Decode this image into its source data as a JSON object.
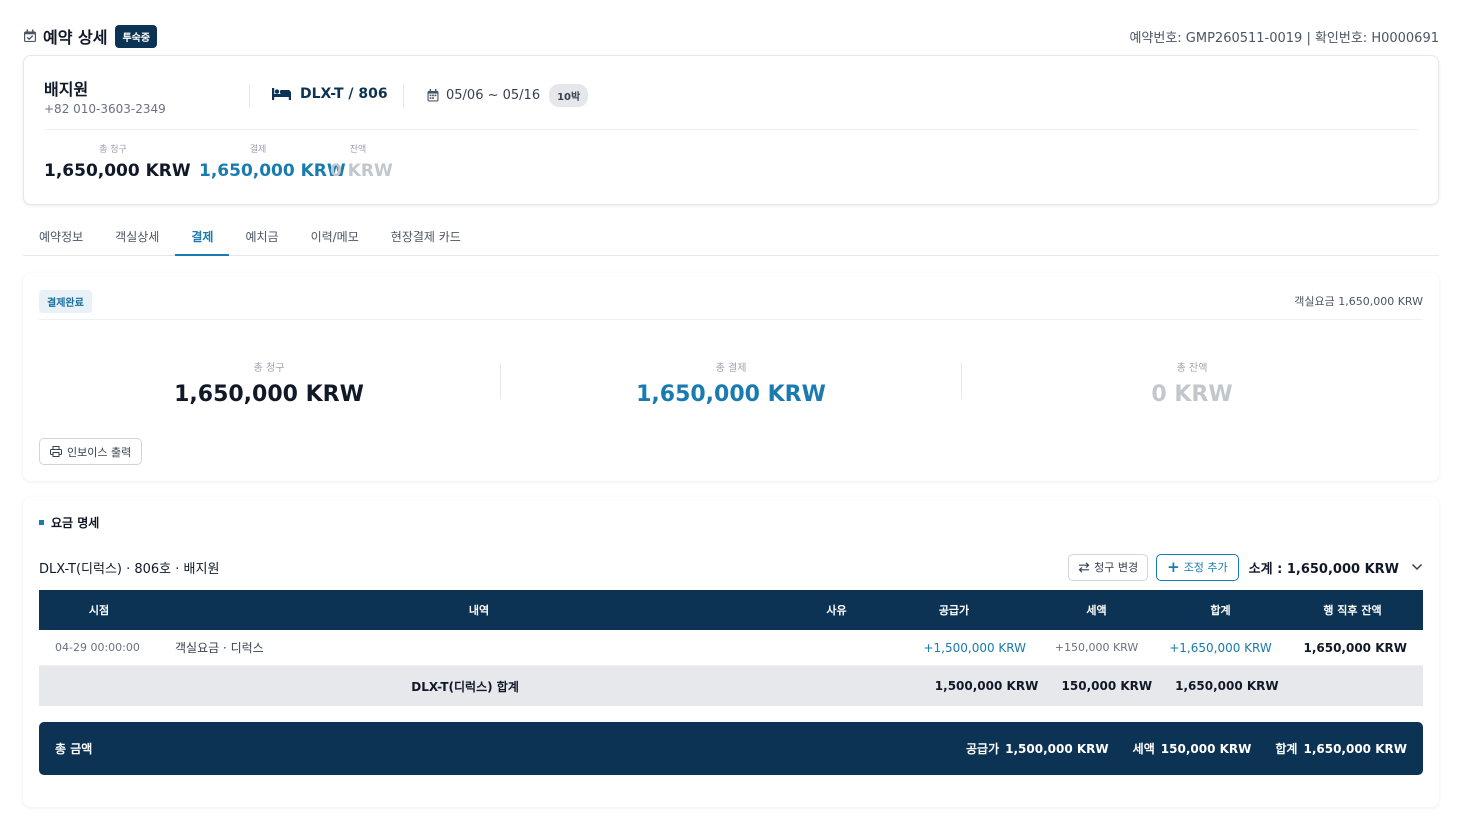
{
  "header": {
    "title": "예약 상세",
    "status": "투숙중",
    "booking_ids": "예약번호: GMP260511-0019 | 확인번호: H0000691"
  },
  "summary": {
    "guest_name": "배지원",
    "guest_phone": "+82 010-3603-2349",
    "room": "DLX-T / 806",
    "dates": "05/06 ~ 05/16",
    "nights": "10박",
    "total_label": "총 청구",
    "total_value": "1,650,000 KRW",
    "paid_label": "결제",
    "paid_value": "1,650,000 KRW",
    "balance_label": "잔액",
    "balance_value": "0 KRW"
  },
  "tabs": [
    {
      "label": "예약정보"
    },
    {
      "label": "객실상세"
    },
    {
      "label": "결제"
    },
    {
      "label": "예치금"
    },
    {
      "label": "이력/메모"
    },
    {
      "label": "현장결제 카드"
    }
  ],
  "payment": {
    "status_badge": "결제완료",
    "room_charge": "객실요금 1,650,000 KRW",
    "total_charge_label": "총 청구",
    "total_charge_value": "1,650,000 KRW",
    "total_paid_label": "총 결제",
    "total_paid_value": "1,650,000 KRW",
    "total_balance_label": "총 잔액",
    "total_balance_value": "0 KRW",
    "invoice_button": "인보이스 출력"
  },
  "fees": {
    "section_title": "요금 명세",
    "group_title": "DLX-T(디럭스) · 806호 · 배지원",
    "change_billing_button": "청구 변경",
    "add_adjustment_button": "조정 추가",
    "subtotal": "소계 : 1,650,000 KRW",
    "columns": {
      "time": "시점",
      "detail": "내역",
      "reason": "사유",
      "supply": "공급가",
      "tax": "세액",
      "total": "합계",
      "balance": "행 직후 잔액"
    },
    "rows": [
      {
        "time": "04-29 00:00:00",
        "detail": "객실요금 · 디럭스",
        "reason": "",
        "supply": "+1,500,000 KRW",
        "tax": "+150,000 KRW",
        "total": "+1,650,000 KRW",
        "balance": "1,650,000 KRW"
      }
    ],
    "group_sum": {
      "label": "DLX-T(디럭스) 합계",
      "supply": "1,500,000 KRW",
      "tax": "150,000 KRW",
      "total": "1,650,000 KRW"
    },
    "grand_total": {
      "label": "총 금액",
      "supply_key": "공급가",
      "supply_value": "1,500,000 KRW",
      "tax_key": "세액",
      "tax_value": "150,000 KRW",
      "total_key": "합계",
      "total_value": "1,650,000 KRW"
    }
  },
  "icons": [
    "calendar-check-icon",
    "bed-icon",
    "calendar-icon",
    "printer-icon",
    "swap-arrows-icon",
    "plus-icon",
    "chevron-down-icon"
  ],
  "colors": {
    "navy": "#0c3354",
    "accent_blue": "#1a7bb0",
    "muted": "#c2c7ce"
  }
}
